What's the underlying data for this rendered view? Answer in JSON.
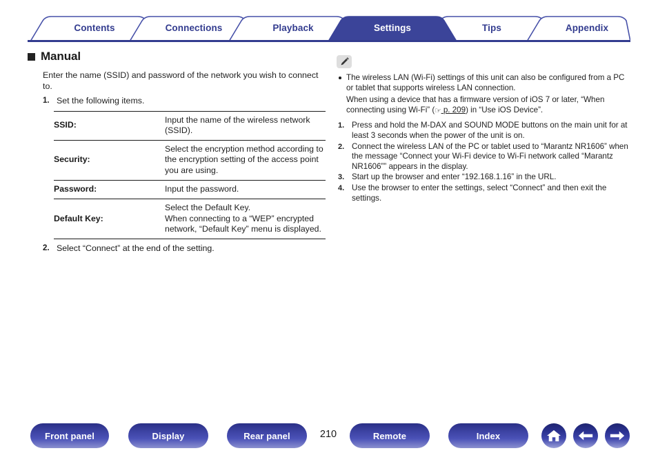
{
  "colors": {
    "brand_blue": "#333c8f",
    "active_tab_bg": "#3b4499",
    "tab_text": "#333c8f",
    "active_tab_text": "#ffffff",
    "body_text": "#1f1f1f",
    "note_icon_bg": "#dedede"
  },
  "tabs": [
    {
      "label": "Contents",
      "active": false
    },
    {
      "label": "Connections",
      "active": false
    },
    {
      "label": "Playback",
      "active": false
    },
    {
      "label": "Settings",
      "active": true
    },
    {
      "label": "Tips",
      "active": false
    },
    {
      "label": "Appendix",
      "active": false
    }
  ],
  "left": {
    "heading": "Manual",
    "intro": "Enter the name (SSID) and password of the network you wish to connect to.",
    "step1_num": "1.",
    "step1_text": "Set the following items.",
    "table": [
      {
        "key": "SSID:",
        "value": "Input the name of the wireless network (SSID)."
      },
      {
        "key": "Security:",
        "value": "Select the encryption method according to the encryption setting of the access point you are using."
      },
      {
        "key": "Password:",
        "value": "Input the password."
      },
      {
        "key": "Default Key:",
        "value": "Select the Default Key.\nWhen connecting to a “WEP” encrypted network, “Default Key” menu is displayed."
      }
    ],
    "step2_num": "2.",
    "step2_text": "Select “Connect” at the end of the setting."
  },
  "right": {
    "icon_name": "pencil-note-icon",
    "bullet_text": "The wireless LAN (Wi-Fi) settings of this unit can also be configured from a PC or tablet that supports wireless LAN connection.",
    "sub_prefix": "When using a device that has a firmware version of iOS 7 or later, “When connecting using Wi-Fi” (",
    "link_hand": "☞",
    "link_text": "p. 209",
    "sub_suffix": ") in “Use iOS Device”.",
    "steps": [
      {
        "num": "1.",
        "text": "Press and hold the M-DAX and SOUND MODE buttons on the main unit for at least 3 seconds when the power of the unit is on."
      },
      {
        "num": "2.",
        "text": "Connect the wireless LAN of the PC or tablet used to “Marantz NR1606” when the message “Connect your Wi-Fi device to Wi-Fi network called “Marantz NR1606”” appears in the display."
      },
      {
        "num": "3.",
        "text": "Start up the browser and enter “192.168.1.16” in the URL."
      },
      {
        "num": "4.",
        "text": "Use the browser to enter the settings, select “Connect” and then exit the settings."
      }
    ]
  },
  "footer": {
    "buttons": [
      {
        "label": "Front panel"
      },
      {
        "label": "Display"
      },
      {
        "label": "Rear panel"
      },
      {
        "label": "Remote"
      },
      {
        "label": "Index"
      }
    ],
    "page_number": "210",
    "icons": [
      {
        "name": "home-icon"
      },
      {
        "name": "arrow-left-icon"
      },
      {
        "name": "arrow-right-icon"
      }
    ]
  }
}
